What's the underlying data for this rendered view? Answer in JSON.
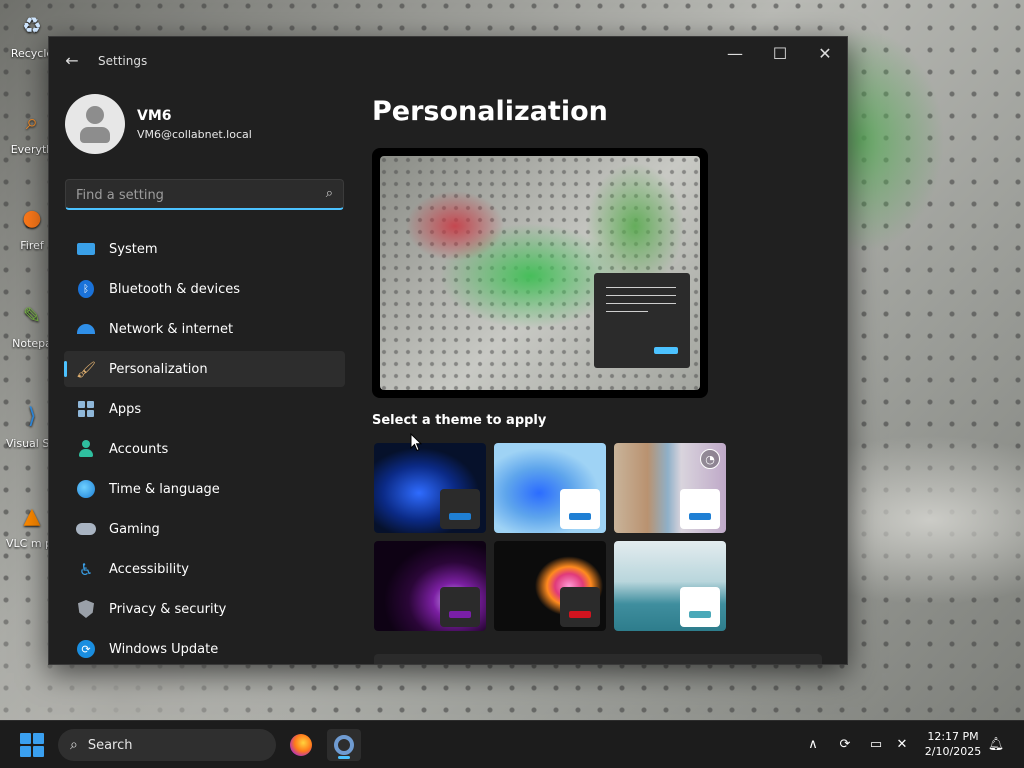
{
  "desktop": {
    "icons": [
      {
        "label": "Recycle",
        "glyph": "♻",
        "icon": "recycle-bin-icon",
        "color": "#cfe6ff"
      },
      {
        "label": "Everyth",
        "glyph": "⌕",
        "icon": "everything-search-icon",
        "color": "#f28c28"
      },
      {
        "label": "Firef",
        "glyph": "●",
        "icon": "firefox-icon",
        "color": "#ff7a1a"
      },
      {
        "label": "Notepa",
        "glyph": "✎",
        "icon": "notepad-icon",
        "color": "#7ab648"
      },
      {
        "label": "Visual S Cod",
        "glyph": "⟩",
        "icon": "vscode-icon",
        "color": "#2f8fe8"
      },
      {
        "label": "VLC m playe",
        "glyph": "▲",
        "icon": "vlc-icon",
        "color": "#ff8a00"
      }
    ]
  },
  "window": {
    "title": "Settings",
    "back_icon": "back-arrow-icon",
    "controls": {
      "minimize": "—",
      "maximize": "☐",
      "close": "✕"
    }
  },
  "profile": {
    "name": "VM6",
    "email": "VM6@collabnet.local"
  },
  "search": {
    "placeholder": "Find a setting",
    "value": ""
  },
  "nav": {
    "items": [
      {
        "label": "System",
        "icon": "system-icon"
      },
      {
        "label": "Bluetooth & devices",
        "icon": "bluetooth-icon"
      },
      {
        "label": "Network & internet",
        "icon": "network-icon"
      },
      {
        "label": "Personalization",
        "icon": "personalization-brush-icon",
        "active": true
      },
      {
        "label": "Apps",
        "icon": "apps-icon"
      },
      {
        "label": "Accounts",
        "icon": "accounts-icon"
      },
      {
        "label": "Time & language",
        "icon": "time-language-icon"
      },
      {
        "label": "Gaming",
        "icon": "gaming-controller-icon"
      },
      {
        "label": "Accessibility",
        "icon": "accessibility-icon"
      },
      {
        "label": "Privacy & security",
        "icon": "privacy-shield-icon"
      },
      {
        "label": "Windows Update",
        "icon": "windows-update-icon"
      }
    ]
  },
  "main": {
    "title": "Personalization",
    "theme_section_label": "Select a theme to apply",
    "themes": [
      {
        "name": "theme-dark-bloom",
        "mini_bg": "#2b2b2b",
        "accent": "#1f7fd4"
      },
      {
        "name": "theme-light-bloom",
        "mini_bg": "#ffffff",
        "accent": "#1f7fd4"
      },
      {
        "name": "theme-spotlight",
        "mini_bg": "#ffffff",
        "accent": "#1f7fd4",
        "slideshow": true
      },
      {
        "name": "theme-glow",
        "mini_bg": "#2b2b2b",
        "accent": "#7a1fa8"
      },
      {
        "name": "theme-captured-motion",
        "mini_bg": "#2b2b2b",
        "accent": "#d1141f"
      },
      {
        "name": "theme-flow",
        "mini_bg": "#ffffff",
        "accent": "#4aa8b8"
      }
    ],
    "accent_color": "#4cc2ff"
  },
  "taskbar": {
    "search_label": "Search",
    "time": "12:17 PM",
    "date": "2/10/2025"
  }
}
